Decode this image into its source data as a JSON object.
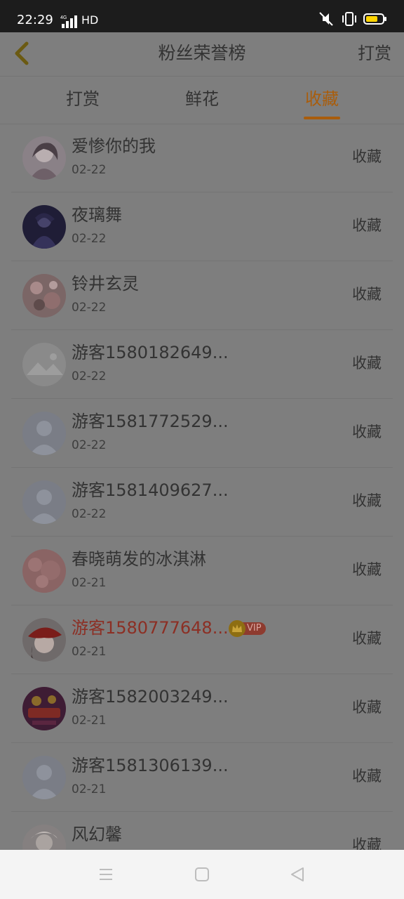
{
  "status_bar": {
    "time": "22:29",
    "network": "4G",
    "hd": "HD"
  },
  "header": {
    "title": "粉丝荣誉榜",
    "action": "打赏"
  },
  "tabs": [
    {
      "label": "打赏"
    },
    {
      "label": "鲜花"
    },
    {
      "label": "收藏"
    }
  ],
  "active_tab": "收藏",
  "rows": [
    {
      "name": "爱惨你的我",
      "date": "02-22",
      "action": "收藏",
      "vip": false
    },
    {
      "name": "夜璃舞",
      "date": "02-22",
      "action": "收藏",
      "vip": false
    },
    {
      "name": "铃井玄灵",
      "date": "02-22",
      "action": "收藏",
      "vip": false
    },
    {
      "name": "游客1580182649...",
      "date": "02-22",
      "action": "收藏",
      "vip": false
    },
    {
      "name": "游客1581772529...",
      "date": "02-22",
      "action": "收藏",
      "vip": false
    },
    {
      "name": "游客1581409627...",
      "date": "02-22",
      "action": "收藏",
      "vip": false
    },
    {
      "name": "春晓萌发的冰淇淋",
      "date": "02-21",
      "action": "收藏",
      "vip": false
    },
    {
      "name": "游客1580777648...",
      "date": "02-21",
      "action": "收藏",
      "vip": true,
      "vip_label": "VIP"
    },
    {
      "name": "游客1582003249...",
      "date": "02-21",
      "action": "收藏",
      "vip": false
    },
    {
      "name": "游客1581306139...",
      "date": "02-21",
      "action": "收藏",
      "vip": false
    },
    {
      "name": "风幻馨",
      "date": "",
      "action": "收藏",
      "vip": false
    }
  ],
  "colors": {
    "accent": "#a95d0c",
    "vip_name": "#8c2f24"
  }
}
